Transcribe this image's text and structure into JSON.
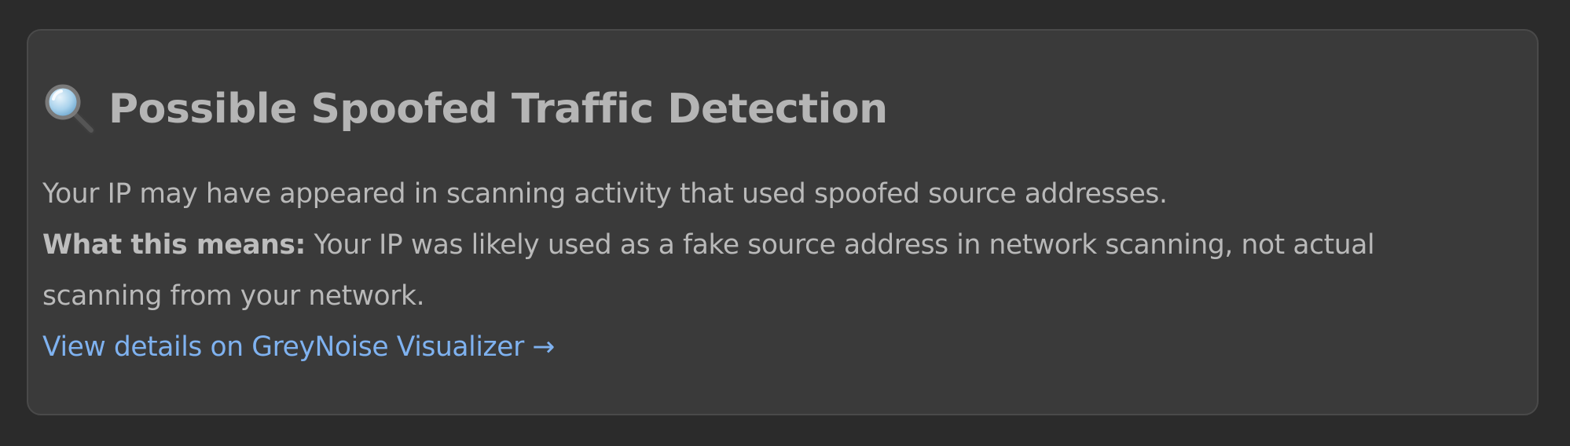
{
  "card": {
    "icon": "magnifying-glass-icon",
    "title": "Possible Spoofed Traffic Detection",
    "description": "Your IP may have appeared in scanning activity that used spoofed source addresses.",
    "means_label": "What this means:",
    "means_text": " Your IP was likely used as a fake source address in network scanning, not actual",
    "means_text_cont": "scanning from your network.",
    "link_label": "View details on GreyNoise Visualizer →"
  },
  "colors": {
    "page_background": "#2b2b2b",
    "card_background": "#3a3a3a",
    "title": "#b5b5b5",
    "text": "#b9b9b9",
    "link": "#7fb2f0"
  }
}
